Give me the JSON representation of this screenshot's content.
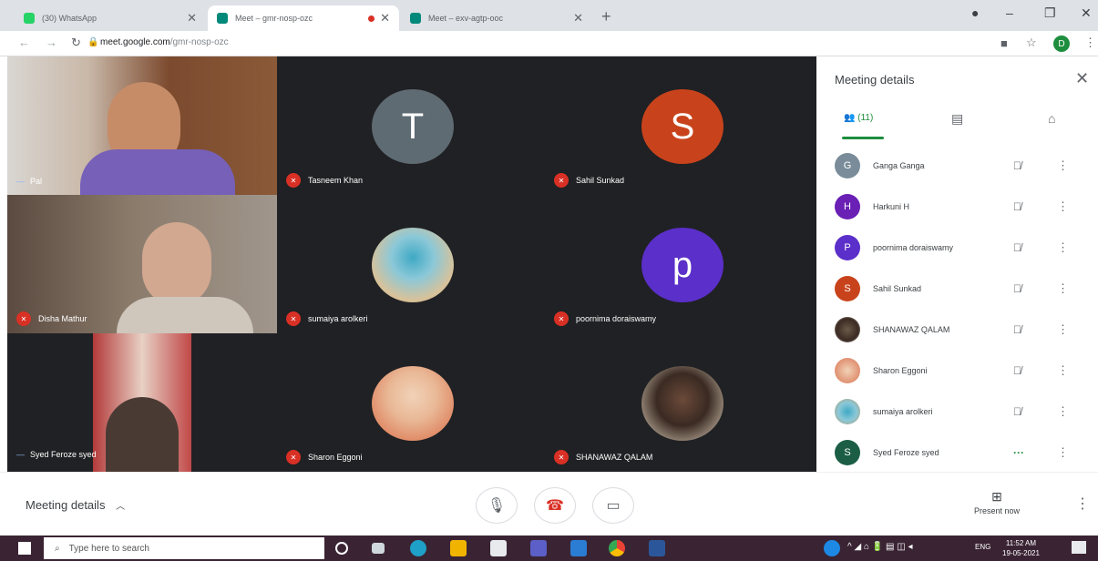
{
  "browser": {
    "tabs": [
      {
        "title": "(30) WhatsApp",
        "color": "#25d366",
        "active": false
      },
      {
        "title": "Meet – gmr-nosp-ozc",
        "color": "#00897b",
        "active": true
      },
      {
        "title": "Meet – exv-agtp-ooc",
        "color": "#00897b",
        "active": false
      }
    ],
    "url_host": "meet.google.com",
    "url_path": "/gmr-nosp-ozc",
    "profile_initial": "D"
  },
  "stage": {
    "tiles": [
      {
        "name": "Pal",
        "kind": "camera"
      },
      {
        "name": "Tasneem Khan",
        "kind": "letter",
        "letter": "T",
        "color": "#5f6b73"
      },
      {
        "name": "Sahil Sunkad",
        "kind": "letter",
        "letter": "S",
        "color": "#c8431c"
      },
      {
        "name": "Disha Mathur",
        "kind": "camera"
      },
      {
        "name": "sumaiya arolkeri",
        "kind": "photo"
      },
      {
        "name": "poornima doraiswamy",
        "kind": "letter",
        "letter": "p",
        "color": "#5b2fc9"
      },
      {
        "name": "Syed Feroze syed",
        "kind": "camera"
      },
      {
        "name": "Sharon Eggoni",
        "kind": "photo"
      },
      {
        "name": "SHANAWAZ QALAM",
        "kind": "photo"
      }
    ]
  },
  "panel": {
    "title": "Meeting details",
    "people_tab": "(11)",
    "participants": [
      {
        "name": "Ganga Ganga",
        "initial": "G",
        "color": "#7a8c99"
      },
      {
        "name": "Harkuni H",
        "initial": "H",
        "color": "#6a1fb5"
      },
      {
        "name": "poornima doraiswamy",
        "initial": "P",
        "color": "#5b2fc9"
      },
      {
        "name": "Sahil Sunkad",
        "initial": "S",
        "color": "#c8431c"
      },
      {
        "name": "SHANAWAZ QALAM",
        "initial": "",
        "color": "#6b5a4a"
      },
      {
        "name": "Sharon Eggoni",
        "initial": "",
        "color": "#c99a78"
      },
      {
        "name": "sumaiya arolkeri",
        "initial": "",
        "color": "#5aa0a0"
      },
      {
        "name": "Syed Feroze syed",
        "initial": "S",
        "color": "#1b5e45"
      }
    ]
  },
  "bottom": {
    "meeting_details": "Meeting details",
    "present_now": "Present now"
  },
  "taskbar": {
    "search_placeholder": "Type here to search",
    "lang": "ENG",
    "time": "11:52 AM",
    "date": "19-05-2021"
  }
}
